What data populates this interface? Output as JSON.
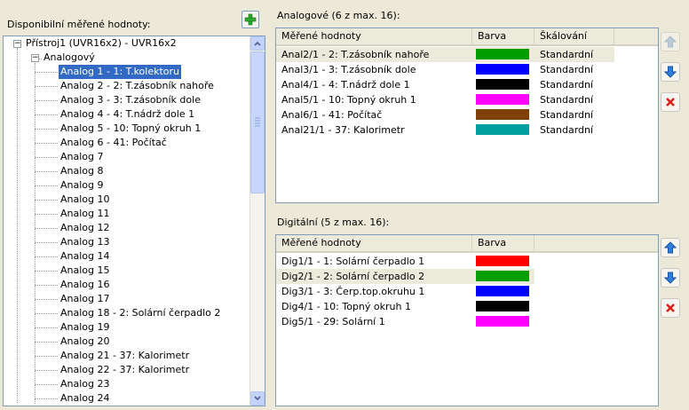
{
  "left": {
    "label": "Disponibilní měřené hodnoty:",
    "root": "Přístroj1 (UVR16x2) - UVR16x2",
    "group": "Analogový",
    "items": [
      "Analog 1 - 1: T.kolektoru",
      "Analog 2 - 2: T.zásobník nahoře",
      "Analog 3 - 3: T.zásobník dole",
      "Analog 4 - 4: T.nádrž dole 1",
      "Analog 5 - 10: Topný okruh 1",
      "Analog 6 - 41: Počítač",
      "Analog 7",
      "Analog 8",
      "Analog 9",
      "Analog 10",
      "Analog 11",
      "Analog 12",
      "Analog 13",
      "Analog 14",
      "Analog 15",
      "Analog 16",
      "Analog 17",
      "Analog 18 - 2: Solární čerpadlo 2",
      "Analog 19",
      "Analog 20",
      "Analog 21 - 37: Kalorimetr",
      "Analog 22 - 37: Kalorimetr",
      "Analog 23",
      "Analog 24"
    ],
    "selected_index": 0
  },
  "analog": {
    "title": "Analogové (6 z max. 16):",
    "headers": [
      "Měřené hodnoty",
      "Barva",
      "Škálování"
    ],
    "rows": [
      {
        "name": "Anal2/1 - 2: T.zásobník nahoře",
        "color": "#009e00",
        "scaling": "Standardní"
      },
      {
        "name": "Anal3/1 - 3: T.zásobník dole",
        "color": "#0000ff",
        "scaling": "Standardní"
      },
      {
        "name": "Anal4/1 - 4: T.nádrž dole 1",
        "color": "#000000",
        "scaling": "Standardní"
      },
      {
        "name": "Anal5/1 - 10: Topný okruh 1",
        "color": "#ff00ff",
        "scaling": "Standardní"
      },
      {
        "name": "Anal6/1 - 41: Počítač",
        "color": "#804000",
        "scaling": "Standardní"
      },
      {
        "name": "Anal21/1 - 37: Kalorimetr",
        "color": "#00a0a0",
        "scaling": "Standardní"
      }
    ]
  },
  "digital": {
    "title": "Digitální (5 z max. 16):",
    "headers": [
      "Měřené hodnoty",
      "Barva"
    ],
    "rows": [
      {
        "name": "Dig1/1 - 1: Solární čerpadlo 1",
        "color": "#ff0000"
      },
      {
        "name": "Dig2/1 - 2: Solární čerpadlo 2",
        "color": "#009e00"
      },
      {
        "name": "Dig3/1 - 3: Čerp.top.okruhu 1",
        "color": "#0000ff"
      },
      {
        "name": "Dig4/1 - 10: Topný okruh 1",
        "color": "#000000"
      },
      {
        "name": "Dig5/1 - 29: Solární 1",
        "color": "#ff00ff"
      }
    ]
  },
  "icons": {
    "add": "plus-icon",
    "up": "arrow-up-icon",
    "down": "arrow-down-icon",
    "delete": "delete-x-icon"
  }
}
